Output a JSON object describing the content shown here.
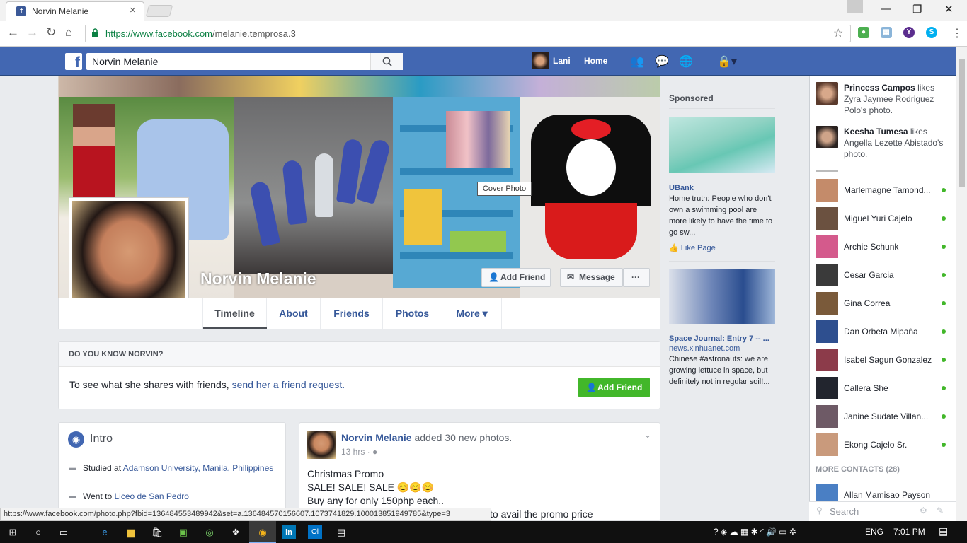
{
  "browser": {
    "tab_title": "Norvin Melanie",
    "url_host": "https://www.facebook.com",
    "url_path": "/melanie.temprosa.3",
    "status_url": "https://www.facebook.com/photo.php?fbid=136484553489942&set=a.136484570156607.1073741829.100013851949785&type=3"
  },
  "fb_header": {
    "search_value": "Norvin Melanie",
    "user_name": "Lani",
    "home_label": "Home"
  },
  "profile": {
    "name": "Norvin Melanie",
    "cover_tooltip": "Cover Photo",
    "add_friend_label": "Add Friend",
    "message_label": "Message",
    "more_dots": "···"
  },
  "tabs": [
    {
      "label": "Timeline"
    },
    {
      "label": "About"
    },
    {
      "label": "Friends"
    },
    {
      "label": "Photos"
    },
    {
      "label": "More ▾"
    }
  ],
  "know": {
    "heading": "DO YOU KNOW NORVIN?",
    "text": "To see what she shares with friends,",
    "link": "send her a friend request.",
    "button": "Add Friend"
  },
  "intro": {
    "title": "Intro",
    "studied_prefix": "Studied at",
    "studied_at": "Adamson University, Manila, Philippines",
    "went_prefix": "Went to",
    "went_to": "Liceo de San Pedro"
  },
  "post": {
    "author": "Norvin Melanie",
    "action": "added 30 new photos.",
    "time": "13 hrs · ",
    "line1": "Christmas Promo",
    "line2": "SALE! SALE! SALE 😊😊😊",
    "line3": "Buy any for only 150php each..",
    "line4": "to avail the promo price"
  },
  "sponsored": {
    "label": "Sponsored",
    "ads": [
      {
        "title": "UBank",
        "text": "Home truth: People who don't own a swimming pool are more likely to have the time to go sw...",
        "action": "Like Page"
      },
      {
        "title": "Space Journal: Entry 7 -- ...",
        "source": "news.xinhuanet.com",
        "text": "Chinese #astronauts: we are growing lettuce in space, but definitely not in regular soil!..."
      }
    ]
  },
  "ticker": [
    {
      "name": "Princess Campos",
      "text": "likes Zyra Jaymee Rodriguez Polo's photo."
    },
    {
      "name": "Keesha Tumesa",
      "text": "likes Angella Lezette Abistado's photo."
    }
  ],
  "contacts": [
    {
      "name": "Marlemagne Tamond..."
    },
    {
      "name": "Miguel Yuri Cajelo"
    },
    {
      "name": "Archie Schunk"
    },
    {
      "name": "Cesar Garcia"
    },
    {
      "name": "Gina Correa"
    },
    {
      "name": "Dan Orbeta Mipaña"
    },
    {
      "name": "Isabel Sagun Gonzalez"
    },
    {
      "name": "Callera She"
    },
    {
      "name": "Janine Sudate Villan..."
    },
    {
      "name": "Ekong Cajelo Sr."
    }
  ],
  "more_contacts": "MORE CONTACTS (28)",
  "more_contact_first": "Allan Mamisao Payson",
  "chat_search_placeholder": "Search",
  "taskbar": {
    "language": "ENG",
    "time": "7:01 PM"
  },
  "colors": {
    "fb_blue": "#4267b2",
    "link": "#365899",
    "online": "#42b72a",
    "add_friend_green": "#42b72a"
  }
}
